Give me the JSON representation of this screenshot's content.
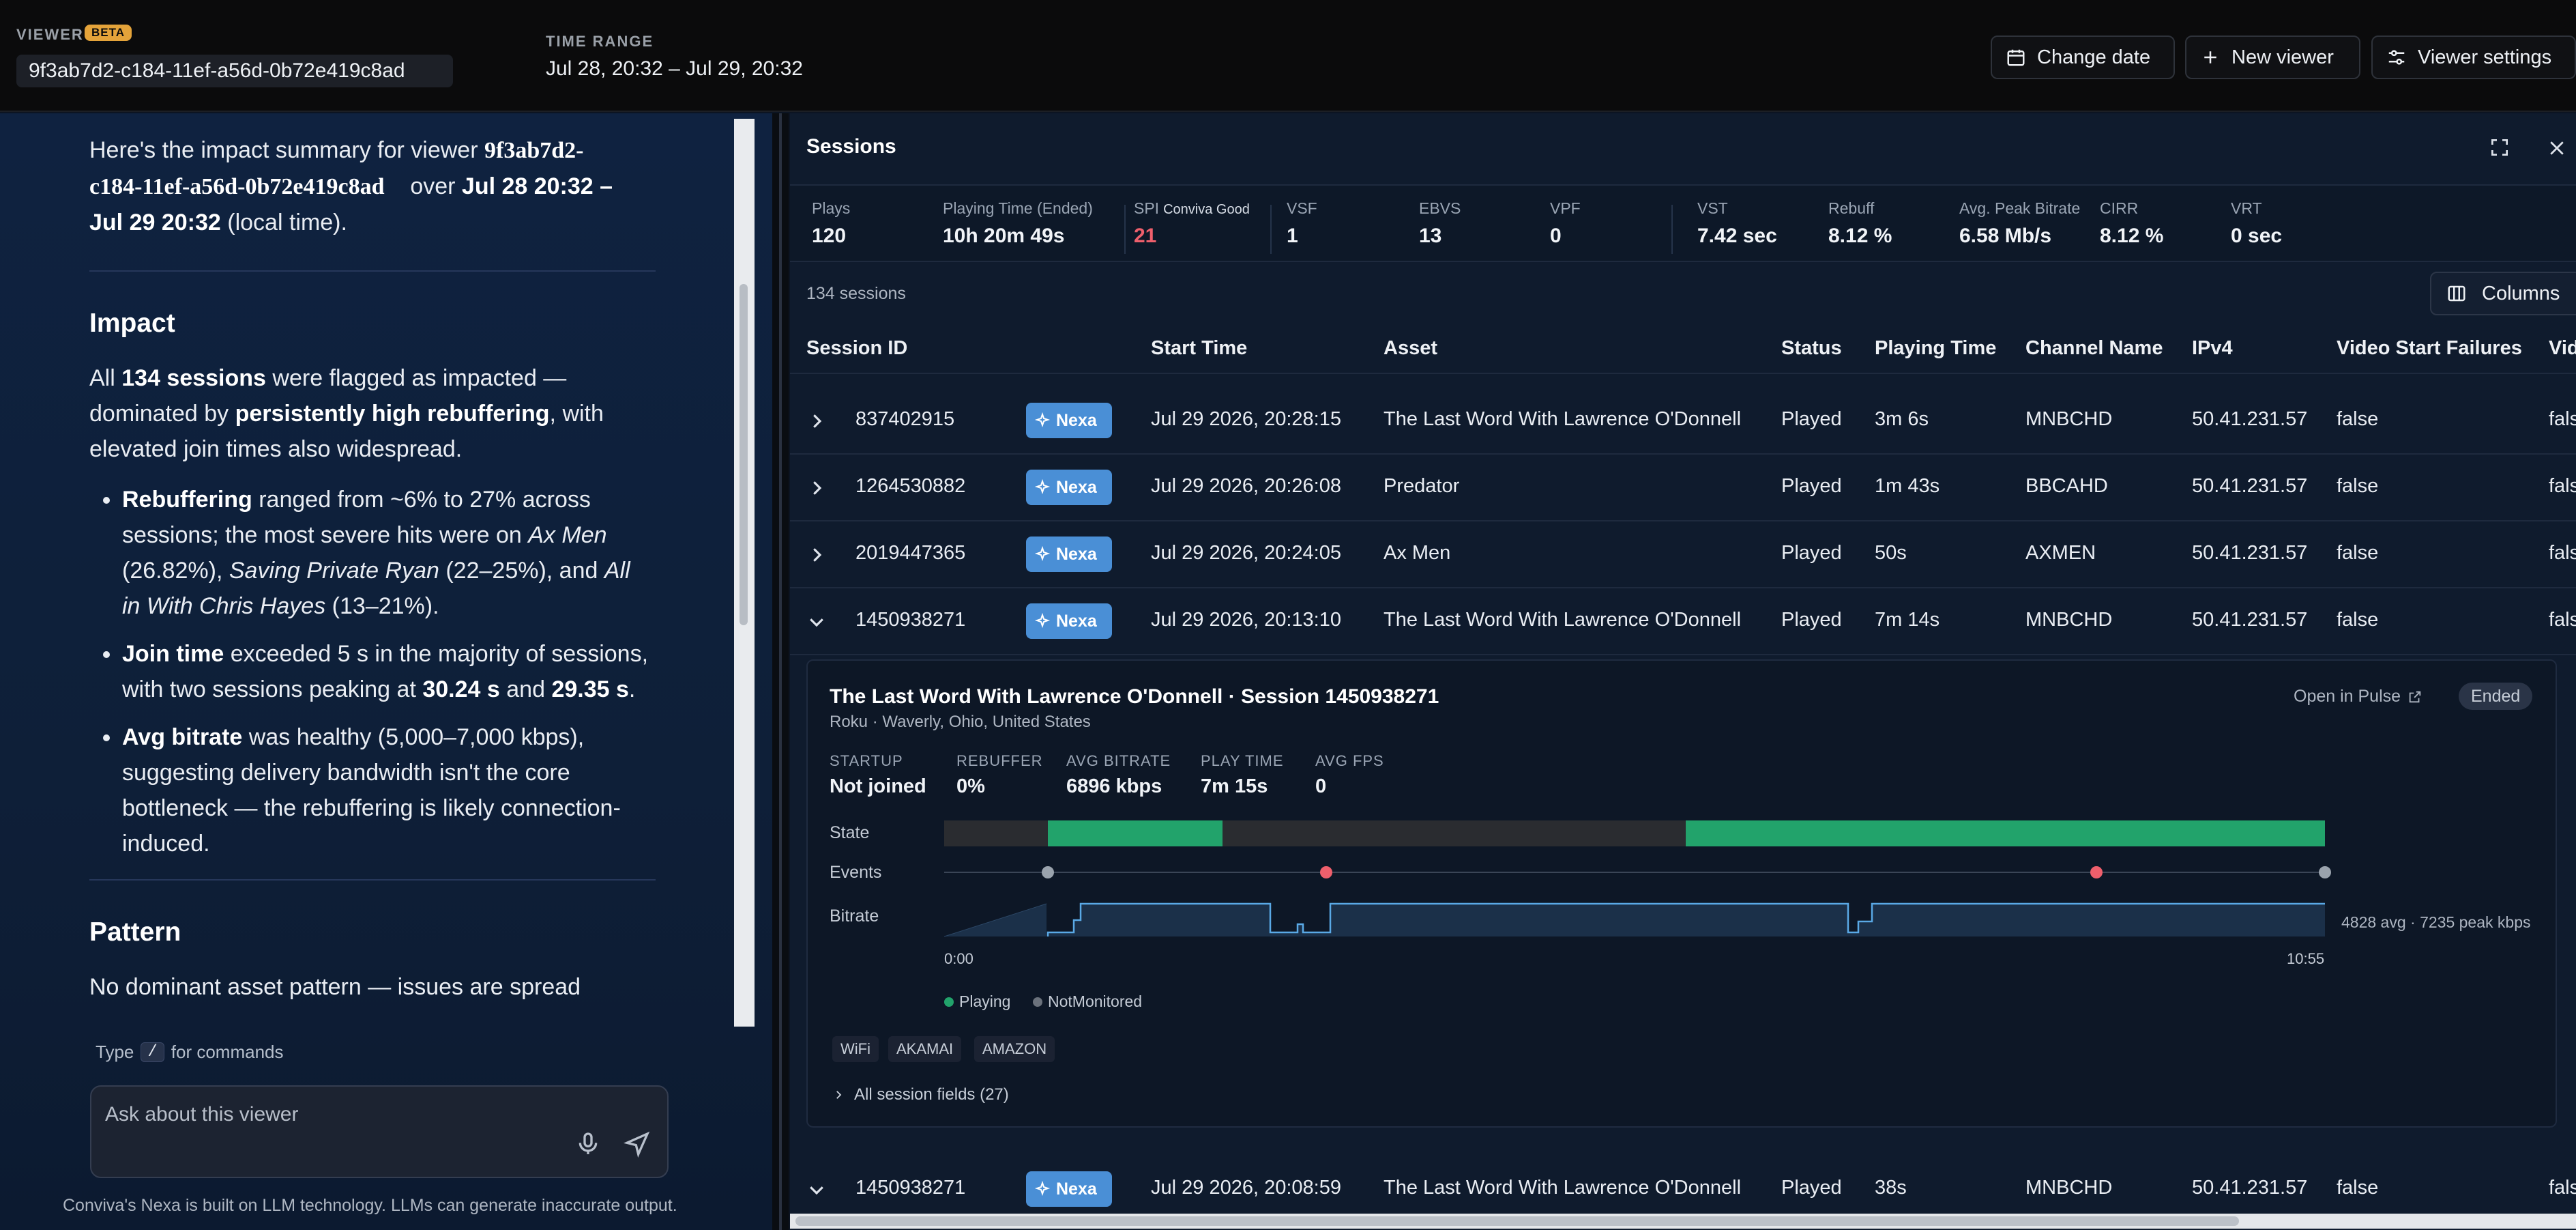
{
  "header": {
    "viewer_label": "VIEWER",
    "beta": "BETA",
    "viewer_id": "9f3ab7d2-c184-11ef-a56d-0b72e419c8ad",
    "time_range_label": "TIME RANGE",
    "time_range_value": "Jul 28, 20:32 – Jul 29, 20:32",
    "buttons": {
      "change_date": "Change date",
      "new_viewer": "New viewer",
      "viewer_settings": "Viewer settings"
    }
  },
  "chat": {
    "intro_prefix": "Here's the impact summary for viewer",
    "intro_id_line1": "9f3ab7d2-",
    "intro_id_line2": "c184-11ef-a56d-0b72e419c8ad",
    "intro_over": "over",
    "intro_range_line1": "Jul 28 20:32 –",
    "intro_range_line2": "Jul 29 20:32",
    "intro_suffix": "(local time).",
    "impact_heading": "Impact",
    "impact_p1": "All",
    "impact_p1_b": "134 sessions",
    "impact_p2": "were flagged as impacted —",
    "impact_p3": "dominated by",
    "impact_p3_b": "persistently high rebuffering",
    "impact_p3_end": ", with",
    "impact_p4": "elevated join times also widespread.",
    "bullet1_b": "Rebuffering",
    "bullet1_a": "ranged from ~6% to 27% across",
    "bullet1_c": "sessions; the most severe hits were on",
    "bullet1_i1": "Ax Men",
    "bullet1_d": "(26.82%),",
    "bullet1_i2": "Saving Private Ryan",
    "bullet1_e": "(22–25%), and",
    "bullet1_i3a": "All",
    "bullet1_i3b": "in With Chris Hayes",
    "bullet1_f": "(13–21%).",
    "bullet2_b": "Join time",
    "bullet2_a": "exceeded 5 s in the majority of sessions,",
    "bullet2_c": "with two sessions peaking at",
    "bullet2_b2": "30.24 s",
    "bullet2_and": "and",
    "bullet2_b3": "29.35 s",
    "bullet2_end": ".",
    "bullet3_b": "Avg bitrate",
    "bullet3_a": "was healthy (5,000–7,000 kbps),",
    "bullet3_c": "suggesting delivery bandwidth isn't the core",
    "bullet3_d": "bottleneck — the rebuffering is likely connection-",
    "bullet3_e": "induced.",
    "pattern_heading": "Pattern",
    "pattern_p": "No dominant asset pattern — issues are spread",
    "cmd_hint_pre": "Type",
    "cmd_key": "/",
    "cmd_hint_post": "for commands",
    "input_placeholder": "Ask about this viewer",
    "disclaimer": "Conviva's Nexa is built on LLM technology. LLMs can generate inaccurate output."
  },
  "sessions": {
    "title": "Sessions",
    "count_text": "134 sessions",
    "columns_button": "Columns",
    "metrics": [
      {
        "label": "Plays",
        "value": "120"
      },
      {
        "label": "Playing Time (Ended)",
        "value": "10h 20m 49s"
      },
      {
        "label": "SPI",
        "sub": "Conviva Good",
        "value": "21"
      },
      {
        "label": "VSF",
        "value": "1"
      },
      {
        "label": "EBVS",
        "value": "13"
      },
      {
        "label": "VPF",
        "value": "0"
      },
      {
        "label": "VST",
        "value": "7.42 sec"
      },
      {
        "label": "Rebuff",
        "value": "8.12 %"
      },
      {
        "label": "Avg. Peak Bitrate",
        "value": "6.58 Mb/s"
      },
      {
        "label": "CIRR",
        "value": "8.12 %"
      },
      {
        "label": "VRT",
        "value": "0 sec"
      }
    ],
    "columns": [
      "Session ID",
      "Start Time",
      "Asset",
      "Status",
      "Playing Time",
      "Channel Name",
      "IPv4",
      "Video Start Failures",
      "Vid"
    ],
    "nexa_label": "Nexa",
    "rows": [
      {
        "id": "837402915",
        "start": "Jul 29 2026, 20:28:15",
        "asset": "The Last Word With Lawrence O'Donnell",
        "status": "Played",
        "playing": "3m 6s",
        "channel": "MNBCHD",
        "ip": "50.41.231.57",
        "vsf": "false",
        "vid": "fals"
      },
      {
        "id": "1264530882",
        "start": "Jul 29 2026, 20:26:08",
        "asset": "Predator",
        "status": "Played",
        "playing": "1m 43s",
        "channel": "BBCAHD",
        "ip": "50.41.231.57",
        "vsf": "false",
        "vid": "fals"
      },
      {
        "id": "2019447365",
        "start": "Jul 29 2026, 20:24:05",
        "asset": "Ax Men",
        "status": "Played",
        "playing": "50s",
        "channel": "AXMEN",
        "ip": "50.41.231.57",
        "vsf": "false",
        "vid": "fals"
      },
      {
        "id": "1450938271",
        "start": "Jul 29 2026, 20:13:10",
        "asset": "The Last Word With Lawrence O'Donnell",
        "status": "Played",
        "playing": "7m 14s",
        "channel": "MNBCHD",
        "ip": "50.41.231.57",
        "vsf": "false",
        "vid": "fals"
      },
      {
        "id": "1450938271",
        "start": "Jul 29 2026, 20:08:59",
        "asset": "The Last Word With Lawrence O'Donnell",
        "status": "Played",
        "playing": "38s",
        "channel": "MNBCHD",
        "ip": "50.41.231.57",
        "vsf": "false",
        "vid": "fals"
      }
    ],
    "detail": {
      "title": "The Last Word With Lawrence O'Donnell · Session 1450938271",
      "subtitle": "Roku · Waverly, Ohio, United States",
      "open_in_pulse": "Open in Pulse",
      "ended": "Ended",
      "stats": [
        {
          "label": "STARTUP",
          "value": "Not joined"
        },
        {
          "label": "REBUFFER",
          "value": "0%"
        },
        {
          "label": "AVG BITRATE",
          "value": "6896 kbps"
        },
        {
          "label": "PLAY TIME",
          "value": "7m 15s"
        },
        {
          "label": "AVG FPS",
          "value": "0"
        }
      ],
      "lane_state": "State",
      "lane_events": "Events",
      "lane_bitrate": "Bitrate",
      "bitrate_summary": "4828 avg · 7235 peak kbps",
      "time_start": "0:00",
      "time_end": "10:55",
      "legend_playing": "Playing",
      "legend_notmonitored": "NotMonitored",
      "tags": [
        "WiFi",
        "AKAMAI",
        "AMAZON"
      ],
      "all_fields": "All session fields (27)",
      "colors": {
        "playing": "#22a36b",
        "not_monitored": "#2a2c30",
        "event_red": "#ef5f6c",
        "event_gray": "#9aa3ad",
        "bitrate_line": "#5aa9e6"
      }
    }
  }
}
